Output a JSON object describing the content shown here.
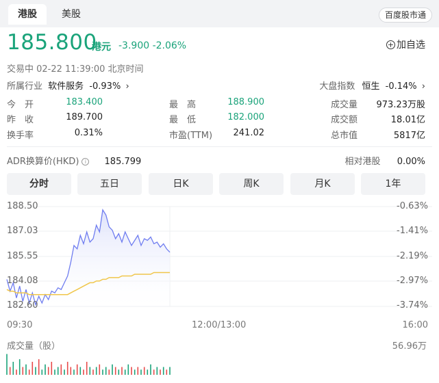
{
  "tabs": [
    "港股",
    "美股"
  ],
  "market_button": "百度股市通",
  "quote": {
    "price": "185.800",
    "currency": "港元",
    "change": "-3.900 -2.06%",
    "add_watch": "加自选"
  },
  "status": "交易中  02-22 11:39:00  北京时间",
  "industry": {
    "label": "所属行业",
    "name": "软件服务",
    "change": "-0.93%"
  },
  "index": {
    "label": "大盘指数",
    "name": "恒生",
    "change": "-0.14%"
  },
  "stats": {
    "open_label": "今　开",
    "open": "183.400",
    "high_label": "最　高",
    "high": "188.900",
    "volume_label": "成交量",
    "volume": "973.23万股",
    "prev_label": "昨　收",
    "prev": "189.700",
    "low_label": "最　低",
    "low": "182.000",
    "turnover_label": "成交额",
    "turnover": "18.01亿",
    "rate_label": "换手率",
    "rate": "0.31%",
    "pe_label": "市盈(TTM)",
    "pe": "241.02",
    "cap_label": "总市值",
    "cap": "5817亿"
  },
  "adr": {
    "label": "ADR换算价(HKD)",
    "value": "185.799",
    "premium_label": "相对港股",
    "premium": "0.00%"
  },
  "periods": [
    "分时",
    "五日",
    "日K",
    "周K",
    "月K",
    "1年"
  ],
  "chart_data": {
    "type": "area",
    "y_left": [
      "188.50",
      "187.03",
      "185.55",
      "184.08",
      "182.60"
    ],
    "y_right": [
      "-0.63%",
      "-1.41%",
      "-2.19%",
      "-2.97%",
      "-3.74%"
    ],
    "ylim": [
      182.6,
      188.5
    ],
    "x_labels": [
      "09:30",
      "12:00/13:00",
      "16:00"
    ],
    "price": [
      184.2,
      183.5,
      184.0,
      183.1,
      183.8,
      182.9,
      183.6,
      182.8,
      183.4,
      182.7,
      183.2,
      182.8,
      183.3,
      183.0,
      183.5,
      183.4,
      183.7,
      183.6,
      184.0,
      184.4,
      185.2,
      186.2,
      186.0,
      186.8,
      186.3,
      187.0,
      186.4,
      186.6,
      187.4,
      187.0,
      188.3,
      188.0,
      187.3,
      187.1,
      186.6,
      186.9,
      186.4,
      187.0,
      186.6,
      186.2,
      186.5,
      186.8,
      186.2,
      186.6,
      186.5,
      186.7,
      186.3,
      186.4,
      186.1,
      186.3,
      186.0,
      185.8
    ],
    "avg": [
      183.6,
      183.5,
      183.5,
      183.4,
      183.4,
      183.4,
      183.4,
      183.3,
      183.3,
      183.3,
      183.3,
      183.3,
      183.3,
      183.3,
      183.3,
      183.3,
      183.3,
      183.3,
      183.3,
      183.3,
      183.4,
      183.5,
      183.6,
      183.7,
      183.8,
      183.9,
      184.0,
      184.0,
      184.1,
      184.1,
      184.2,
      184.2,
      184.3,
      184.3,
      184.3,
      184.3,
      184.4,
      184.4,
      184.4,
      184.4,
      184.5,
      184.5,
      184.5,
      184.5,
      184.5,
      184.5,
      184.6,
      184.6,
      184.6,
      184.6,
      184.6,
      184.6
    ],
    "volume_label": "成交量（股）",
    "volume_max": "56.96万",
    "volume": [
      0.8,
      0.3,
      0.5,
      0.2,
      0.6,
      0.3,
      0.4,
      0.2,
      0.5,
      0.3,
      0.6,
      0.2,
      0.4,
      0.3,
      0.5,
      0.2,
      0.3,
      0.4,
      0.2,
      0.5,
      0.3,
      0.2,
      0.4,
      0.3,
      0.2,
      0.5,
      0.3,
      0.2,
      0.3,
      0.4,
      0.2,
      0.3,
      0.2,
      0.4,
      0.3,
      0.2,
      0.3,
      0.2,
      0.4,
      0.3,
      0.2,
      0.3,
      0.2,
      0.3,
      0.2,
      0.4,
      0.2,
      0.3,
      0.2,
      0.3,
      0.2,
      0.3
    ],
    "volume_up": [
      0,
      1,
      0,
      1,
      0,
      1,
      0,
      1,
      1,
      0,
      1,
      0,
      0,
      1,
      1,
      0,
      0,
      1,
      0,
      1,
      1,
      0,
      1,
      0,
      1,
      1,
      0,
      1,
      0,
      1,
      0,
      0,
      1,
      0,
      1,
      0,
      1,
      0,
      0,
      1,
      0,
      1,
      0,
      1,
      0,
      0,
      1,
      0,
      1,
      0,
      1,
      0
    ],
    "colors": {
      "line": "#6f7df0",
      "fill": "#dfe3fb",
      "avg": "#f0c64a",
      "up": "#e84a4a",
      "down": "#1aa37a"
    }
  }
}
